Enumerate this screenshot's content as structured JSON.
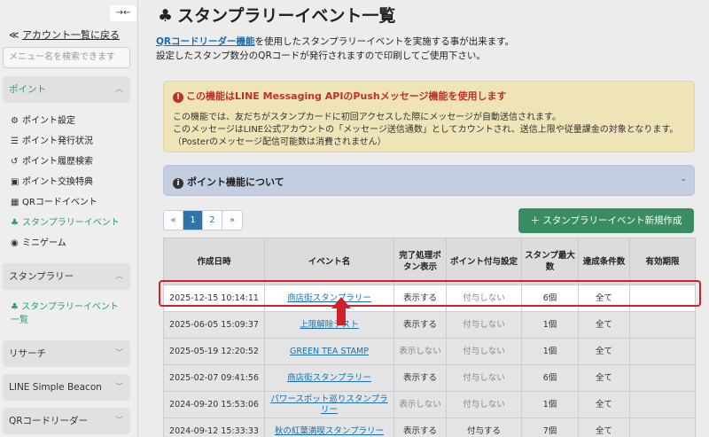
{
  "sidebar": {
    "collapse_label": "→←",
    "back_prefix": "≪",
    "back_label": "アカウント一覧に戻る",
    "search_placeholder": "メニュー名を検索できます",
    "sections": [
      {
        "label": "ポイント",
        "expanded": true
      },
      {
        "label": "スタンプラリー",
        "expanded": true
      },
      {
        "label": "リサーチ",
        "expanded": false
      },
      {
        "label": "LINE Simple Beacon",
        "expanded": false
      },
      {
        "label": "QRコードリーダー",
        "expanded": false
      }
    ],
    "point_items": [
      {
        "label": "ポイント設定",
        "icon": "gear-icon",
        "glyph": "⚙"
      },
      {
        "label": "ポイント発行状況",
        "icon": "coins-icon",
        "glyph": "☰"
      },
      {
        "label": "ポイント履歴検索",
        "icon": "history-icon",
        "glyph": "↺"
      },
      {
        "label": "ポイント交換特典",
        "icon": "gift-icon",
        "glyph": "▣"
      },
      {
        "label": "QRコードイベント",
        "icon": "qrcode-icon",
        "glyph": "▦"
      },
      {
        "label": "スタンプラリーイベント",
        "icon": "stamp-icon",
        "glyph": "♣",
        "active": true
      },
      {
        "label": "ミニゲーム",
        "icon": "gamepad-icon",
        "glyph": "◉"
      }
    ],
    "stamp_item": {
      "label": "スタンプラリーイベント一覧",
      "icon": "stamp-icon",
      "glyph": "♣"
    }
  },
  "header": {
    "title_glyph": "♣",
    "title": "スタンプラリーイベント一覧",
    "intro_link": "QRコードリーダー機能",
    "intro_line1_rest": "を使用したスタンプラリーイベントを実施する事が出来ます。",
    "intro_line2": "設定したスタンプ数分のQRコードが発行されますので印刷してご使用下さい。"
  },
  "alert": {
    "icon_glyph": "!",
    "title": "この機能はLINE Messaging APIのPushメッセージ機能を使用します",
    "lines": [
      "この機能では、友だちがスタンプカードに初回アクセスした際にメッセージが自動送信されます。",
      "このメッセージはLINE公式アカウントの「メッセージ送信通数」としてカウントされ、送信上限や従量課金の対象となります。",
      "（Posterのメッセージ配信可能数は消費されません）"
    ]
  },
  "accordion": {
    "icon_glyph": "i",
    "title": "ポイント機能について",
    "chevron": "⌄"
  },
  "pagination": {
    "first": "«",
    "pages": [
      "1",
      "2"
    ],
    "current": "1",
    "last": "»"
  },
  "create_button": "＋ スタンプラリーイベント新規作成",
  "table": {
    "columns": [
      "作成日時",
      "イベント名",
      "完了処理ボタン表示",
      "ポイント付与設定",
      "スタンプ最大数",
      "達成条件数",
      "有効期限"
    ],
    "rows": [
      [
        "2025-12-15 10:14:11",
        "商店街スタンプラリー",
        "表示する",
        "付与しない",
        "6個",
        "全て",
        ""
      ],
      [
        "2025-06-05 15:09:37",
        "上限解除テスト",
        "表示する",
        "付与しない",
        "1個",
        "全て",
        ""
      ],
      [
        "2025-05-19 12:20:52",
        "GREEN TEA STAMP",
        "表示しない",
        "付与しない",
        "1個",
        "全て",
        ""
      ],
      [
        "2025-02-07 09:41:56",
        "商店街スタンプラリー",
        "表示する",
        "付与しない",
        "6個",
        "全て",
        ""
      ],
      [
        "2024-09-20 15:53:06",
        "パワースポット巡りスタンプラリー",
        "表示しない",
        "付与しない",
        "1個",
        "全て",
        ""
      ],
      [
        "2024-09-12 15:33:33",
        "秋の紅葉満喫スタンプラリー",
        "表示する",
        "付与する",
        "7個",
        "全て",
        ""
      ]
    ]
  }
}
